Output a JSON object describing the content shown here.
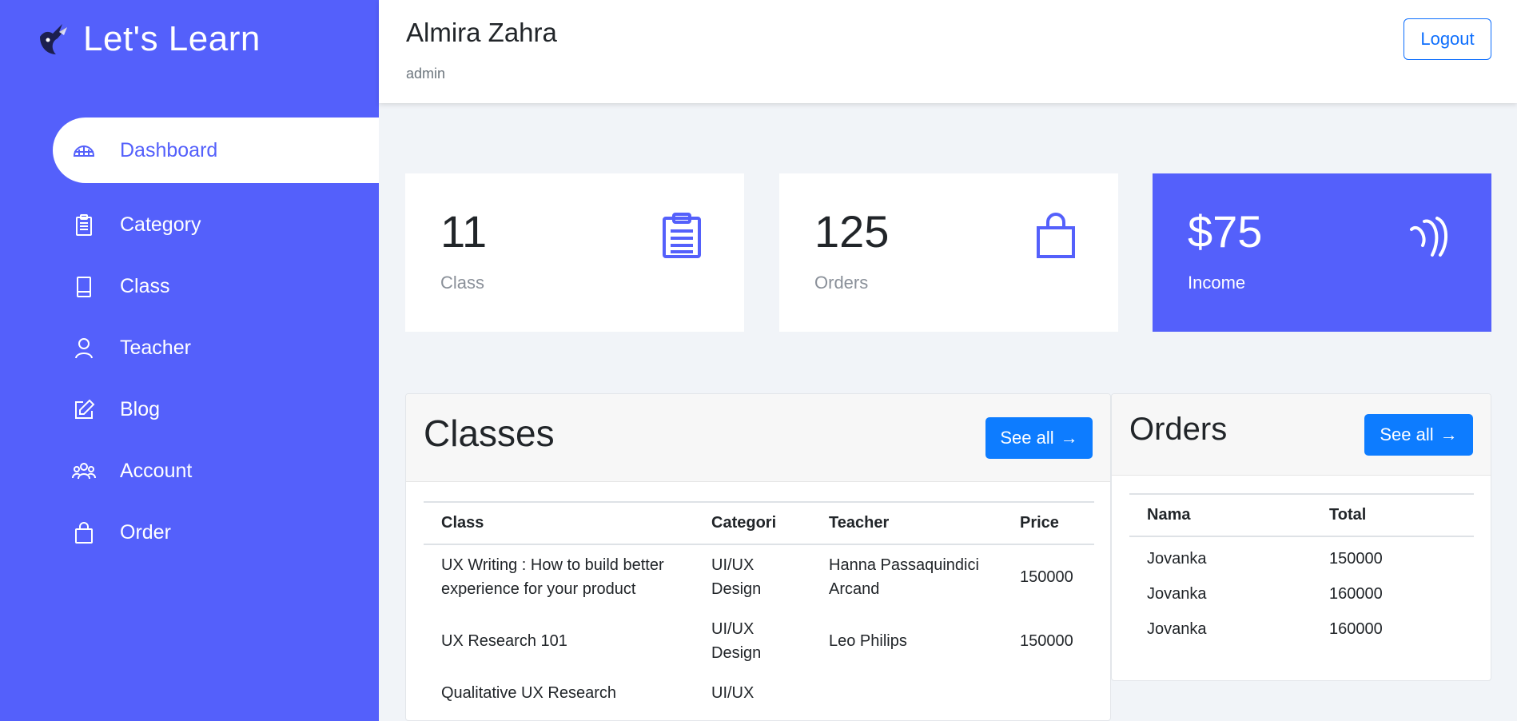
{
  "brand": {
    "name": "Let's Learn",
    "logo_icon": "fox-logo-icon"
  },
  "sidebar": {
    "items": [
      {
        "label": "Dashboard",
        "icon": "dashboard-icon",
        "active": true
      },
      {
        "label": "Category",
        "icon": "clipboard-icon"
      },
      {
        "label": "Class",
        "icon": "book-icon"
      },
      {
        "label": "Teacher",
        "icon": "user-icon"
      },
      {
        "label": "Blog",
        "icon": "edit-icon"
      },
      {
        "label": "Account",
        "icon": "users-icon"
      },
      {
        "label": "Order",
        "icon": "bag-icon"
      }
    ]
  },
  "header": {
    "user_name": "Almira Zahra",
    "user_role": "admin",
    "logout_label": "Logout"
  },
  "cards": [
    {
      "value": "11",
      "caption": "Class",
      "icon": "clipboard-icon"
    },
    {
      "value": "125",
      "caption": "Orders",
      "icon": "bag-icon"
    },
    {
      "value": "$75",
      "caption": "Income",
      "icon": "income-icon"
    }
  ],
  "classes_panel": {
    "title": "Classes",
    "see_all_label": "See all",
    "columns": [
      "Class",
      "Categori",
      "Teacher",
      "Price"
    ],
    "rows": [
      [
        "UX Writing : How to build better experience for your product",
        "UI/UX Design",
        "Hanna Passaquindici Arcand",
        "150000"
      ],
      [
        "UX Research 101",
        "UI/UX Design",
        "Leo Philips",
        "150000"
      ],
      [
        "Qualitative UX Research",
        "UI/UX",
        "",
        ""
      ]
    ]
  },
  "orders_panel": {
    "title": "Orders",
    "see_all_label": "See all",
    "columns": [
      "Nama",
      "Total"
    ],
    "rows": [
      [
        "Jovanka",
        "150000"
      ],
      [
        "Jovanka",
        "160000"
      ],
      [
        "Jovanka",
        "160000"
      ]
    ]
  },
  "colors": {
    "primary": "#5460fb",
    "button_blue": "#0d7cff",
    "background": "#f1f4f8"
  }
}
